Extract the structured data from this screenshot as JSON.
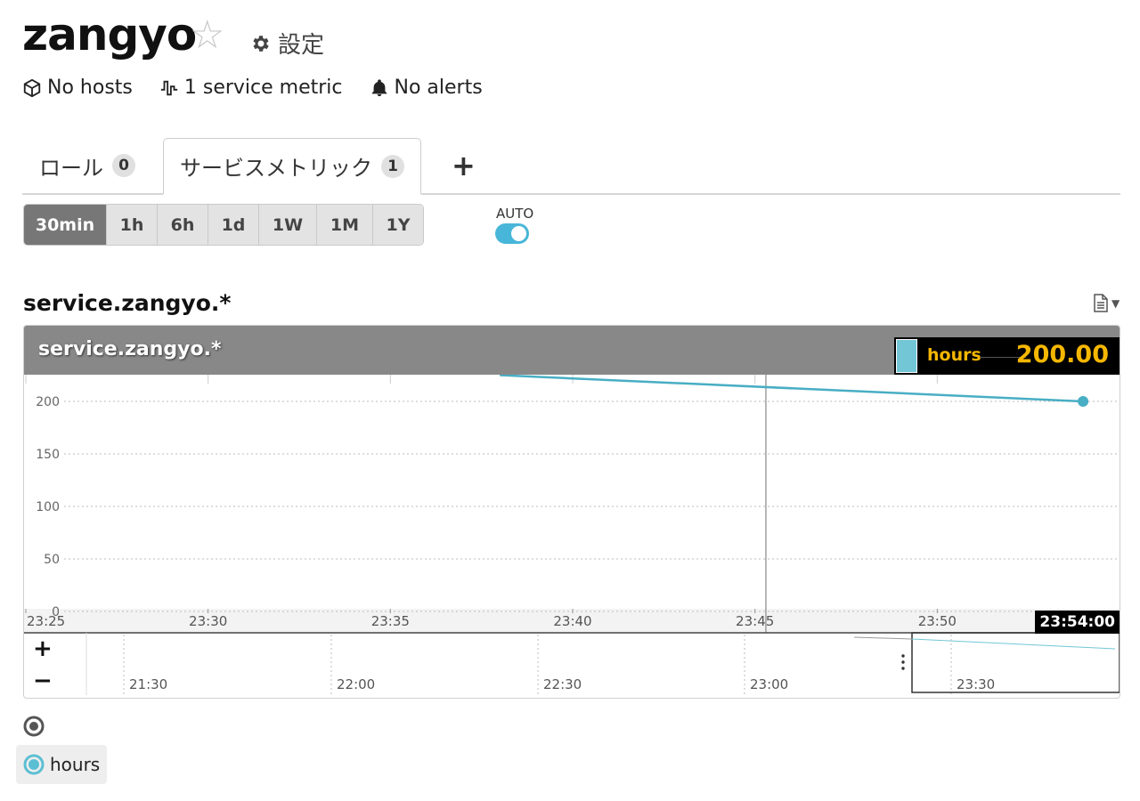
{
  "service": {
    "name": "zangyo",
    "star_icon": "star-outline-icon",
    "settings_label": "設定"
  },
  "summary": {
    "hosts": "No hosts",
    "metrics": "1 service metric",
    "alerts": "No alerts"
  },
  "tabs": [
    {
      "label": "ロール",
      "count": "0"
    },
    {
      "label": "サービスメトリック",
      "count": "1"
    }
  ],
  "tab_add": "+",
  "ranges": [
    "30min",
    "1h",
    "6h",
    "1d",
    "1W",
    "1M",
    "1Y"
  ],
  "active_range": "30min",
  "auto": {
    "label": "AUTO",
    "enabled": true
  },
  "graph": {
    "section_title": "service.zangyo.*",
    "header_title": "service.zangyo.*",
    "legend": {
      "name": "hours",
      "value": "200.00",
      "color": "#72c6d6"
    },
    "current_time": "23:54:00",
    "zoom_in": "+",
    "zoom_out": "−",
    "overview_ticks": [
      "21:30",
      "22:00",
      "22:30",
      "23:00",
      "23:30"
    ]
  },
  "chart_data": {
    "type": "line",
    "x_ticks": [
      "23:25",
      "23:30",
      "23:35",
      "23:40",
      "23:45",
      "23:50"
    ],
    "y_ticks": [
      0,
      50,
      100,
      150,
      200
    ],
    "ylim": [
      0,
      225
    ],
    "xlim_minutes": [
      0,
      30
    ],
    "series": [
      {
        "name": "hours",
        "color": "#48aec4",
        "x_minutes": [
          13,
          29
        ],
        "values": [
          225,
          200
        ]
      }
    ],
    "crosshair_minutes": 20.3,
    "grid": true
  },
  "bottom_legend": {
    "item_label": "hours"
  }
}
